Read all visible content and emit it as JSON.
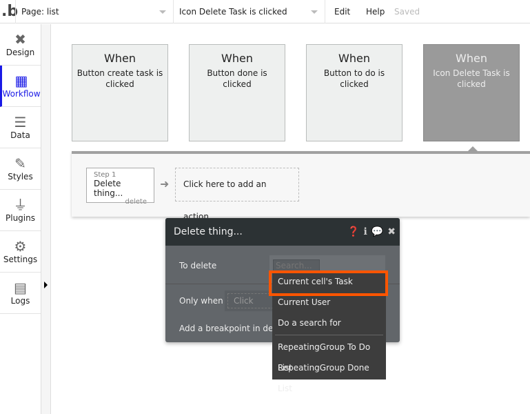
{
  "header": {
    "logo": ".b",
    "page_select": "Page: list",
    "event_select": "Icon Delete Task is clicked",
    "menu": [
      "Edit",
      "Help"
    ],
    "status": "Saved"
  },
  "sidebar": {
    "items": [
      {
        "label": "Design",
        "icon": "design-icon"
      },
      {
        "label": "Workflow",
        "icon": "workflow-icon",
        "active": true
      },
      {
        "label": "Data",
        "icon": "database-icon"
      },
      {
        "label": "Styles",
        "icon": "brush-icon"
      },
      {
        "label": "Plugins",
        "icon": "plug-icon"
      },
      {
        "label": "Settings",
        "icon": "gear-icon"
      },
      {
        "label": "Logs",
        "icon": "document-icon"
      }
    ]
  },
  "events": [
    {
      "when": "When",
      "desc": "Button create task is clicked"
    },
    {
      "when": "When",
      "desc": "Button done is clicked"
    },
    {
      "when": "When",
      "desc": "Button to do is clicked"
    },
    {
      "when": "When",
      "desc": "Icon Delete Task is clicked",
      "selected": true
    }
  ],
  "workflow": {
    "step_num": "Step 1",
    "step_name": "Delete thing...",
    "step_delete": "delete",
    "add_action": "Click here to add an action..."
  },
  "popup": {
    "title": "Delete thing...",
    "to_delete_label": "To delete",
    "search_placeholder": "Search...",
    "only_when_label": "Only when",
    "click_placeholder": "Click",
    "breakpoint_label": "Add a breakpoint in deb"
  },
  "dropdown": {
    "items": [
      "Current cell's Task",
      "Current User",
      "Do a search for",
      "RepeatingGroup To Do List",
      "RepeatingGroup Done List"
    ],
    "highlight_color": "#ff5500"
  }
}
